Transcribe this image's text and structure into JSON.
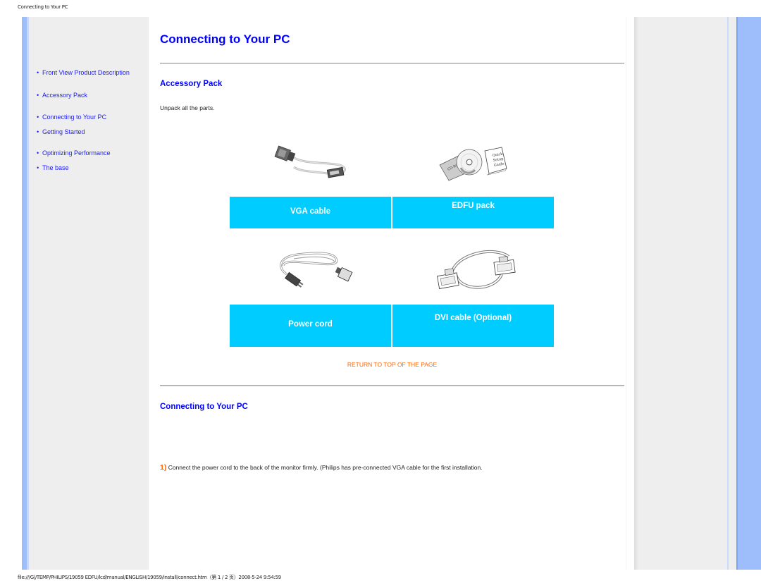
{
  "page_header": "Connecting to Your PC",
  "page_footer": "file:///G|/TEMP/PHILIPS/19059 EDFU/lcd/manual/ENGLISH/19059/install/connect.htm（第 1 / 2 页）2008-5-24 9:54:59",
  "sidebar": {
    "items": [
      {
        "label": "Front View Product Description"
      },
      {
        "label": "Accessory Pack"
      },
      {
        "label": "Connecting to Your PC"
      },
      {
        "label": "Getting Started"
      },
      {
        "label": "Optimizing Performance"
      },
      {
        "label": "The base"
      }
    ]
  },
  "main": {
    "title": "Connecting to Your PC",
    "accessory_section": {
      "title": "Accessory Pack",
      "intro": "Unpack all the parts.",
      "items": [
        {
          "label": "VGA cable",
          "image": "vga-cable-image"
        },
        {
          "label": "EDFU pack",
          "image": "edfu-pack-image"
        },
        {
          "label": "Power cord",
          "image": "power-cord-image"
        },
        {
          "label": "DVI cable (Optional)",
          "image": "dvi-cable-image"
        }
      ],
      "cd_label": "CD-ROM",
      "guide_label": [
        "Quick",
        "Setup",
        "Guide"
      ]
    },
    "return_link": "RETURN TO TOP OF THE PAGE",
    "connect_section": {
      "title": "Connecting to Your PC",
      "step_number": "1)",
      "step_text": " Connect the power cord to the back of the monitor firmly. (Philips has pre-connected VGA cable for the first installation."
    }
  },
  "colors": {
    "link": "#1a1aff",
    "heading": "#0000ff",
    "label_box": "#00ccff",
    "accent_orange": "#ff6600",
    "sidebar_blue": "#9dbdfb",
    "panel_gray": "#eeeeee"
  }
}
